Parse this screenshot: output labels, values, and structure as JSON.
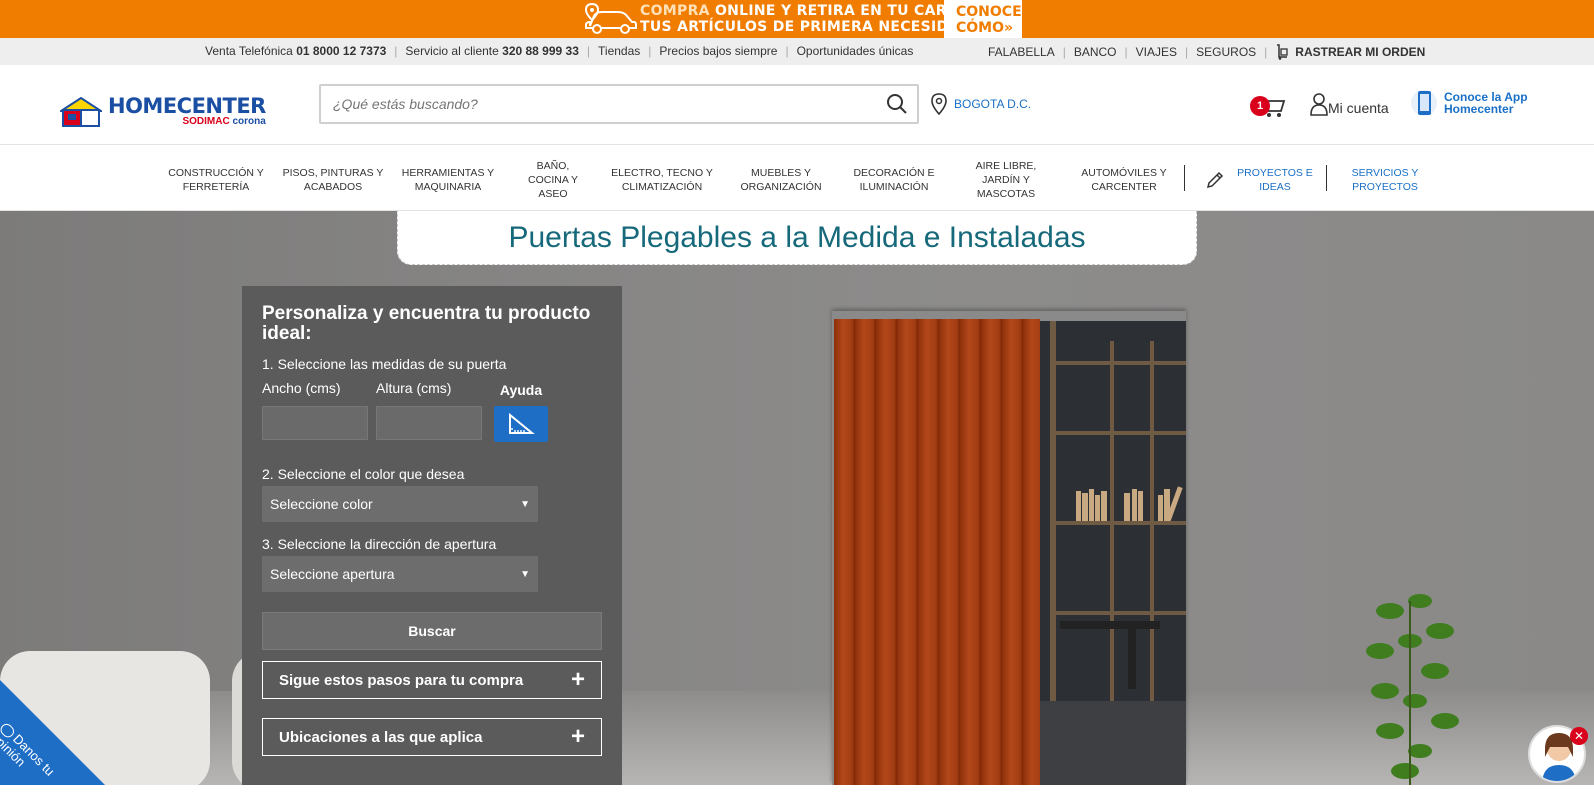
{
  "promo": {
    "line1_a": "COMPRA ",
    "line1_b": "ONLINE Y RETIRA EN TU CARRO",
    "line2": "TUS ARTÍCULOS DE PRIMERA NECESIDAD",
    "cta_line1": "CONOCE",
    "cta_line2": "CÓMO",
    "cta_arrow": "»"
  },
  "util": {
    "sales_label": "Venta Telefónica",
    "sales_phone": "01 8000 12 7373",
    "service_label": "Servicio al cliente",
    "service_phone": "320 88 999 33",
    "stores": "Tiendas",
    "low_prices": "Precios bajos siempre",
    "opportunities": "Oportunidades únicas",
    "right": [
      "FALABELLA",
      "BANCO",
      "VIAJES",
      "SEGUROS"
    ],
    "track": "RASTREAR MI ORDEN"
  },
  "header": {
    "logo_main": "HOMECENTER",
    "logo_sub1": "SODIMAC",
    "logo_sub2": "corona",
    "search_placeholder": "¿Qué estás buscando?",
    "location": "BOGOTA D.C.",
    "cart_count": "1",
    "account": "Mi cuenta",
    "app_line1": "Conoce la App",
    "app_line2": "Homecenter"
  },
  "nav": {
    "items": [
      "Construcción y ferretería",
      "Pisos, pinturas y acabados",
      "Herramientas y maquinaria",
      "Baño, cocina y aseo",
      "Electro, tecno y climatización",
      "Muebles y organización",
      "Decoración e iluminación",
      "Aire libre, jardín y mascotas",
      "Automóviles y carcenter"
    ],
    "projects": "Proyectos e ideas",
    "services": "Servicios y proyectos"
  },
  "hero": {
    "title": "Puertas Plegables a la Medida e Instaladas",
    "panel_title": "Personaliza y encuentra tu producto ideal:",
    "step1": "1. Seleccione las medidas de su puerta",
    "width_label": "Ancho (cms)",
    "height_label": "Altura (cms)",
    "help_label": "Ayuda",
    "step2": "2. Seleccione el color que desea",
    "color_select": "Seleccione color",
    "step3": "3. Seleccione la dirección de apertura",
    "opening_select": "Seleccione apertura",
    "search_button": "Buscar",
    "accordion1": "Sigue estos pasos para tu compra",
    "accordion2": "Ubicaciones a las que aplica"
  },
  "feedback": {
    "label": "Danos tu opinión"
  },
  "colors": {
    "orange": "#f07d00",
    "blue": "#1a70c6",
    "brand_blue": "#1b4fa3",
    "red": "#d8001a",
    "teal": "#16697a"
  }
}
